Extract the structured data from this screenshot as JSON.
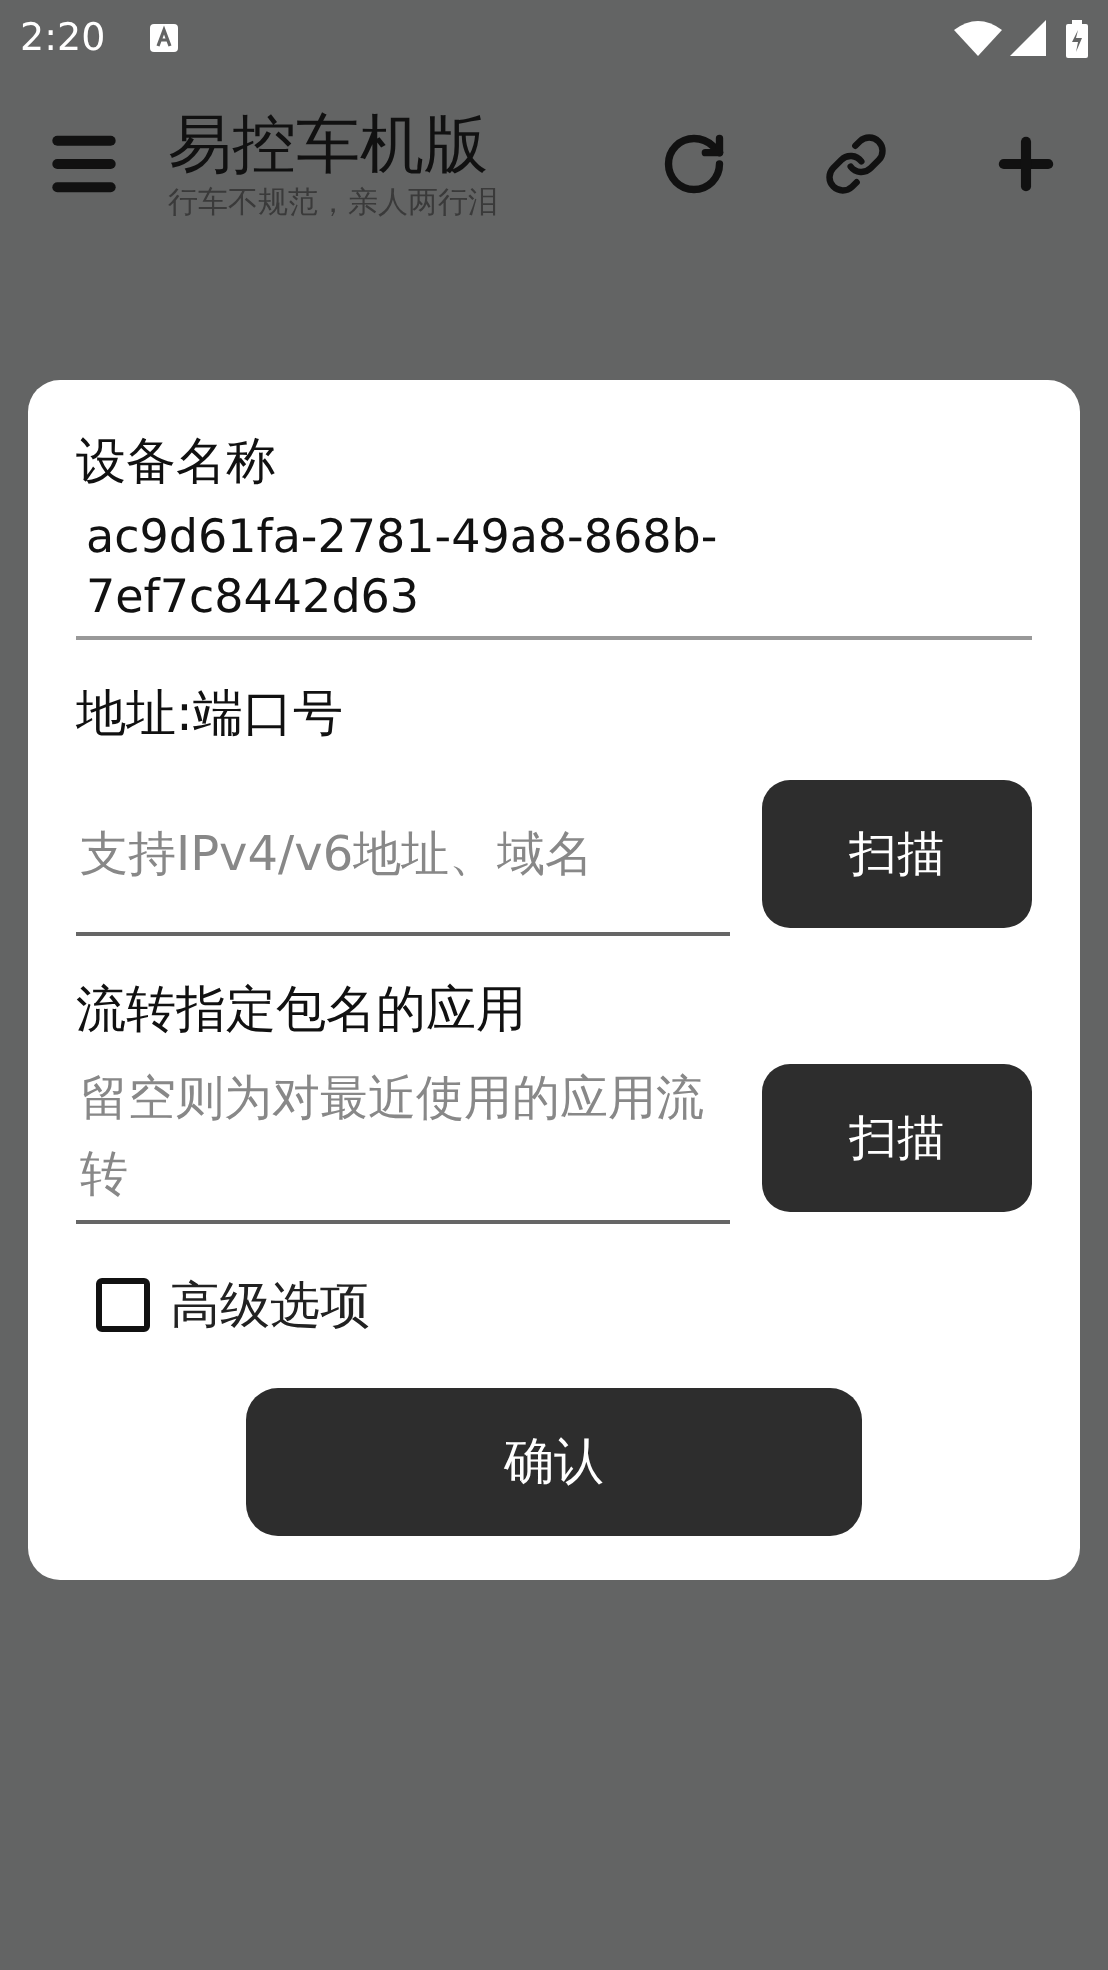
{
  "status_bar": {
    "time": "2:20"
  },
  "app_bar": {
    "title": "易控车机版",
    "subtitle": "行车不规范，亲人两行泪"
  },
  "dialog": {
    "device_name": {
      "label": "设备名称",
      "value": "ac9d61fa-2781-49a8-868b-7ef7c8442d63"
    },
    "address": {
      "label": "地址:端口号",
      "placeholder": "支持IPv4/v6地址、域名",
      "button": "扫描"
    },
    "package": {
      "label": "流转指定包名的应用",
      "placeholder": "留空则为对最近使用的应用流转",
      "button": "扫描"
    },
    "advanced": {
      "label": "高级选项",
      "checked": false
    },
    "confirm": "确认"
  }
}
